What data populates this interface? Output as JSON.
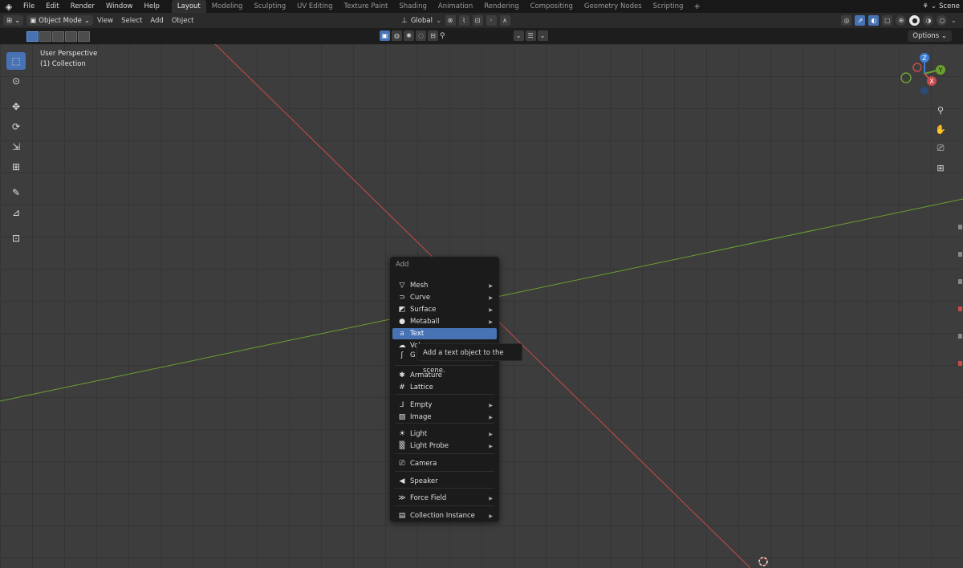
{
  "topbar": {
    "menus": [
      "File",
      "Edit",
      "Render",
      "Window",
      "Help"
    ],
    "workspaces": [
      "Layout",
      "Modeling",
      "Sculpting",
      "UV Editing",
      "Texture Paint",
      "Shading",
      "Animation",
      "Rendering",
      "Compositing",
      "Geometry Nodes",
      "Scripting"
    ],
    "active_workspace": "Layout",
    "add_tab": "+",
    "scene_label": "Scene"
  },
  "header": {
    "mode": "Object Mode",
    "menus": [
      "View",
      "Select",
      "Add",
      "Object"
    ],
    "transform_orientation": "Global"
  },
  "subheader": {
    "options_label": "Options"
  },
  "viewport": {
    "perspective": "User Perspective",
    "collection": "(1) Collection",
    "axis_colors": {
      "x": "#c84a4a",
      "y": "#6ba02f",
      "z": "#3f7fd6"
    },
    "gizmo_labels": {
      "z": "Z",
      "y": "Y",
      "x": "X"
    }
  },
  "add_menu": {
    "title": "Add",
    "items": [
      {
        "label": "Mesh",
        "icon": "mesh-icon",
        "submenu": true
      },
      {
        "label": "Curve",
        "icon": "curve-icon",
        "submenu": true
      },
      {
        "label": "Surface",
        "icon": "surface-icon",
        "submenu": true
      },
      {
        "label": "Metaball",
        "icon": "metaball-icon",
        "submenu": true
      },
      {
        "label": "Text",
        "icon": "text-icon",
        "submenu": false,
        "highlighted": true
      },
      {
        "label": "Volume",
        "icon": "volume-icon",
        "submenu": true
      },
      {
        "label": "G",
        "icon": "grease-pencil-icon",
        "submenu": false
      },
      {
        "label": "Armature",
        "icon": "armature-icon",
        "submenu": false
      },
      {
        "label": "Lattice",
        "icon": "lattice-icon",
        "submenu": false
      },
      {
        "label": "Empty",
        "icon": "empty-icon",
        "submenu": true
      },
      {
        "label": "Image",
        "icon": "image-icon",
        "submenu": true
      },
      {
        "label": "Light",
        "icon": "light-icon",
        "submenu": true
      },
      {
        "label": "Light Probe",
        "icon": "light-probe-icon",
        "submenu": true
      },
      {
        "label": "Camera",
        "icon": "camera-icon",
        "submenu": false
      },
      {
        "label": "Speaker",
        "icon": "speaker-icon",
        "submenu": false
      },
      {
        "label": "Force Field",
        "icon": "force-field-icon",
        "submenu": true
      },
      {
        "label": "Collection Instance",
        "icon": "collection-instance-icon",
        "submenu": true
      }
    ]
  },
  "tooltip": {
    "text": "Add a text object to the scene."
  },
  "colors": {
    "accent": "#4772b3",
    "background": "#3d3d3d",
    "menu_bg": "#1b1b1b"
  }
}
